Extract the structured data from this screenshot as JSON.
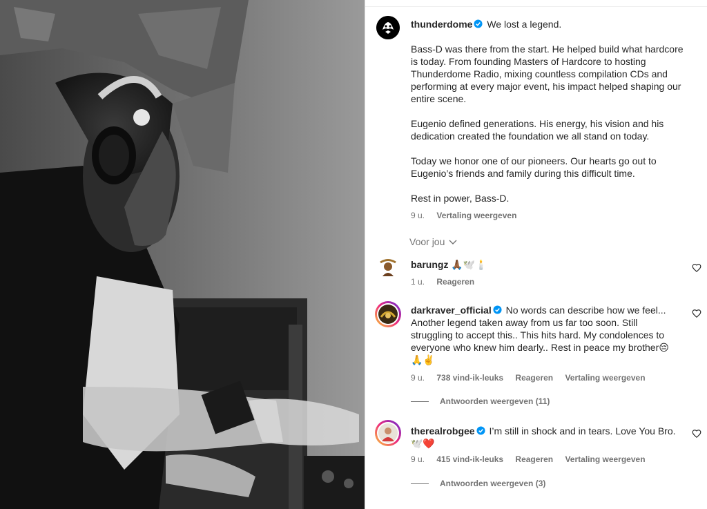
{
  "post": {
    "username": "thunderdome",
    "title": "We lost a legend.",
    "paragraphs": [
      "Bass-D was there from the start. He helped build what hardcore is today. From founding Masters of Hardcore to hosting Thunderdome Radio, mixing countless compilation CDs and performing at every major event, his impact helped shaping our entire scene.",
      "Eugenio defined generations. His energy, his vision and his dedication created the foundation we all stand on today.",
      "Today we honor one of our pioneers. Our hearts go out to Eugenio’s friends and family during this difficult time.",
      "Rest in power, Bass-D."
    ],
    "time": "9 u.",
    "translate": "Vertaling weergeven"
  },
  "for_you": "Voor jou",
  "comments": [
    {
      "username": "barungz",
      "text": "🙏🏾🕊️🕯️",
      "time": "1 u.",
      "reply": "Reageren",
      "verified": false
    },
    {
      "username": "darkraver_official",
      "text": "No words can describe how we feel... Another legend taken away from us far too soon. Still struggling to accept this.. This hits hard. My condolences to everyone who knew him dearly.. Rest in peace my brother😔🙏✌️",
      "time": "9 u.",
      "likes": "738 vind-ik-leuks",
      "reply": "Reageren",
      "translate": "Vertaling weergeven",
      "view_replies": "Antwoorden weergeven (11)",
      "verified": true
    },
    {
      "username": "therealrobgee",
      "text": "I’m still in shock and in tears. Love You Bro. 🕊️❤️",
      "time": "9 u.",
      "likes": "415 vind-ik-leuks",
      "reply": "Reageren",
      "translate": "Vertaling weergeven",
      "view_replies": "Antwoorden weergeven (3)",
      "verified": true
    }
  ],
  "colors": {
    "verified": "#0095f6",
    "meta": "#737373",
    "text": "#262626"
  },
  "icons": {
    "verified": "verified-badge-icon",
    "like": "heart-outline-icon",
    "expand": "chevron-down-icon"
  }
}
